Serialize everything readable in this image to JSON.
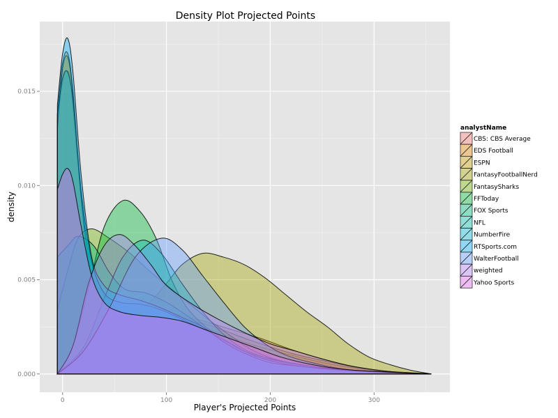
{
  "chart_data": {
    "type": "area",
    "subtype": "density",
    "title": "Density Plot Projected Points",
    "xlabel": "Player's Projected Points",
    "ylabel": "density",
    "xlim": [
      -22,
      373
    ],
    "ylim": [
      -0.00097,
      0.0187
    ],
    "x_ticks": [
      0,
      100,
      200,
      300
    ],
    "x_tick_labels": [
      "0",
      "100",
      "200",
      "300"
    ],
    "y_ticks": [
      0.0,
      0.005,
      0.01,
      0.015
    ],
    "y_tick_labels": [
      "0.000",
      "0.005",
      "0.010",
      "0.015"
    ],
    "grid": true,
    "legend": {
      "title": "analystName",
      "position": "right"
    },
    "series": [
      {
        "name": "CBS: CBS Average",
        "color": "#F8766D",
        "points": [
          [
            -5,
            0.0135
          ],
          [
            0,
            0.0155
          ],
          [
            4,
            0.0161
          ],
          [
            8,
            0.0153
          ],
          [
            15,
            0.011
          ],
          [
            25,
            0.0065
          ],
          [
            40,
            0.0042
          ],
          [
            60,
            0.0036
          ],
          [
            80,
            0.0035
          ],
          [
            100,
            0.0033
          ],
          [
            130,
            0.0029
          ],
          [
            160,
            0.0024
          ],
          [
            190,
            0.0019
          ],
          [
            220,
            0.0013
          ],
          [
            250,
            0.0008
          ],
          [
            280,
            0.0004
          ],
          [
            320,
            0.0001
          ],
          [
            355,
            0.0
          ]
        ]
      },
      {
        "name": "EDS Football",
        "color": "#E58700",
        "points": [
          [
            -5,
            0.0138
          ],
          [
            0,
            0.0165
          ],
          [
            5,
            0.017
          ],
          [
            10,
            0.015
          ],
          [
            18,
            0.0095
          ],
          [
            28,
            0.0055
          ],
          [
            45,
            0.0038
          ],
          [
            70,
            0.0033
          ],
          [
            100,
            0.003
          ],
          [
            140,
            0.0024
          ],
          [
            180,
            0.0016
          ],
          [
            220,
            0.001
          ],
          [
            260,
            0.0005
          ],
          [
            300,
            0.0002
          ],
          [
            355,
            0.0
          ]
        ]
      },
      {
        "name": "ESPN",
        "color": "#C99800",
        "points": [
          [
            -5,
            0.013
          ],
          [
            0,
            0.0162
          ],
          [
            5,
            0.0168
          ],
          [
            10,
            0.0148
          ],
          [
            18,
            0.0092
          ],
          [
            28,
            0.0052
          ],
          [
            45,
            0.0037
          ],
          [
            70,
            0.0034
          ],
          [
            100,
            0.0031
          ],
          [
            140,
            0.0026
          ],
          [
            180,
            0.0018
          ],
          [
            220,
            0.0011
          ],
          [
            260,
            0.0006
          ],
          [
            300,
            0.0002
          ],
          [
            355,
            0.0
          ]
        ]
      },
      {
        "name": "FantasyFootballNerd",
        "color": "#A3A500",
        "points": [
          [
            -5,
            0.0
          ],
          [
            20,
            0.0012
          ],
          [
            50,
            0.0025
          ],
          [
            80,
            0.0036
          ],
          [
            100,
            0.0048
          ],
          [
            115,
            0.0058
          ],
          [
            135,
            0.0064
          ],
          [
            155,
            0.0062
          ],
          [
            175,
            0.0058
          ],
          [
            195,
            0.0051
          ],
          [
            215,
            0.0042
          ],
          [
            235,
            0.0033
          ],
          [
            255,
            0.0025
          ],
          [
            275,
            0.0016
          ],
          [
            295,
            0.0009
          ],
          [
            315,
            0.0005
          ],
          [
            335,
            0.0002
          ],
          [
            355,
            0.0
          ]
        ]
      },
      {
        "name": "FantasySharks",
        "color": "#6BB100",
        "points": [
          [
            -5,
            0.0034
          ],
          [
            5,
            0.0055
          ],
          [
            15,
            0.0072
          ],
          [
            28,
            0.0077
          ],
          [
            45,
            0.0072
          ],
          [
            65,
            0.0064
          ],
          [
            85,
            0.0054
          ],
          [
            105,
            0.0045
          ],
          [
            125,
            0.0036
          ],
          [
            145,
            0.0027
          ],
          [
            165,
            0.0019
          ],
          [
            185,
            0.0012
          ],
          [
            210,
            0.0007
          ],
          [
            240,
            0.0004
          ],
          [
            280,
            0.0002
          ],
          [
            355,
            0.0
          ]
        ]
      },
      {
        "name": "FFToday",
        "color": "#00BA38",
        "points": [
          [
            -5,
            0.0
          ],
          [
            10,
            0.0015
          ],
          [
            25,
            0.0045
          ],
          [
            40,
            0.0078
          ],
          [
            58,
            0.0092
          ],
          [
            75,
            0.0086
          ],
          [
            90,
            0.0072
          ],
          [
            105,
            0.005
          ],
          [
            120,
            0.0035
          ],
          [
            140,
            0.0024
          ],
          [
            160,
            0.0017
          ],
          [
            180,
            0.0011
          ],
          [
            210,
            0.0007
          ],
          [
            250,
            0.0003
          ],
          [
            300,
            0.0001
          ],
          [
            355,
            0.0
          ]
        ]
      },
      {
        "name": "FOX Sports",
        "color": "#00BF7D",
        "points": [
          [
            -5,
            0.0062
          ],
          [
            5,
            0.0068
          ],
          [
            15,
            0.0073
          ],
          [
            30,
            0.0068
          ],
          [
            45,
            0.0054
          ],
          [
            60,
            0.0045
          ],
          [
            80,
            0.0043
          ],
          [
            100,
            0.0038
          ],
          [
            125,
            0.0029
          ],
          [
            150,
            0.0019
          ],
          [
            175,
            0.0011
          ],
          [
            205,
            0.0007
          ],
          [
            240,
            0.0004
          ],
          [
            280,
            0.0002
          ],
          [
            355,
            0.0
          ]
        ]
      },
      {
        "name": "NFL",
        "color": "#00C0AF",
        "points": [
          [
            -5,
            0.0
          ],
          [
            20,
            0.0014
          ],
          [
            40,
            0.004
          ],
          [
            58,
            0.0062
          ],
          [
            77,
            0.0071
          ],
          [
            95,
            0.0064
          ],
          [
            115,
            0.0048
          ],
          [
            135,
            0.0033
          ],
          [
            155,
            0.0021
          ],
          [
            175,
            0.0013
          ],
          [
            200,
            0.0008
          ],
          [
            230,
            0.0005
          ],
          [
            270,
            0.0002
          ],
          [
            355,
            0.0
          ]
        ]
      },
      {
        "name": "NumberFire",
        "color": "#00BCD8",
        "points": [
          [
            -5,
            0.0138
          ],
          [
            0,
            0.0157
          ],
          [
            5,
            0.016
          ],
          [
            10,
            0.0145
          ],
          [
            18,
            0.0097
          ],
          [
            28,
            0.006
          ],
          [
            40,
            0.0043
          ],
          [
            55,
            0.0038
          ],
          [
            75,
            0.0037
          ],
          [
            95,
            0.0034
          ],
          [
            115,
            0.0029
          ],
          [
            135,
            0.0024
          ],
          [
            155,
            0.0018
          ],
          [
            175,
            0.0012
          ],
          [
            200,
            0.0007
          ],
          [
            230,
            0.0004
          ],
          [
            270,
            0.0002
          ],
          [
            355,
            0.0
          ]
        ]
      },
      {
        "name": "RTSports.com",
        "color": "#00B0F6",
        "points": [
          [
            -5,
            0.0143
          ],
          [
            0,
            0.017
          ],
          [
            5,
            0.0178
          ],
          [
            10,
            0.016
          ],
          [
            18,
            0.0105
          ],
          [
            28,
            0.0062
          ],
          [
            40,
            0.0047
          ],
          [
            55,
            0.0042
          ],
          [
            75,
            0.0039
          ],
          [
            95,
            0.0035
          ],
          [
            115,
            0.003
          ],
          [
            135,
            0.0025
          ],
          [
            155,
            0.0017
          ],
          [
            175,
            0.0011
          ],
          [
            200,
            0.0006
          ],
          [
            230,
            0.0004
          ],
          [
            270,
            0.0002
          ],
          [
            355,
            0.0
          ]
        ]
      },
      {
        "name": "WalterFootball",
        "color": "#619CFF",
        "points": [
          [
            -5,
            0.0
          ],
          [
            20,
            0.0012
          ],
          [
            45,
            0.0035
          ],
          [
            70,
            0.0062
          ],
          [
            95,
            0.0072
          ],
          [
            115,
            0.0066
          ],
          [
            135,
            0.0052
          ],
          [
            155,
            0.0038
          ],
          [
            175,
            0.0025
          ],
          [
            195,
            0.0016
          ],
          [
            215,
            0.001
          ],
          [
            240,
            0.0006
          ],
          [
            280,
            0.0002
          ],
          [
            355,
            0.0
          ]
        ]
      },
      {
        "name": "weighted",
        "color": "#B983FF",
        "points": [
          [
            -5,
            0.0
          ],
          [
            10,
            0.0015
          ],
          [
            25,
            0.0048
          ],
          [
            40,
            0.0068
          ],
          [
            55,
            0.0074
          ],
          [
            70,
            0.0068
          ],
          [
            85,
            0.0058
          ],
          [
            100,
            0.0047
          ],
          [
            125,
            0.0037
          ],
          [
            150,
            0.0029
          ],
          [
            175,
            0.0022
          ],
          [
            200,
            0.0016
          ],
          [
            225,
            0.0012
          ],
          [
            250,
            0.0008
          ],
          [
            280,
            0.0004
          ],
          [
            320,
            0.0001
          ],
          [
            355,
            0.0
          ]
        ]
      },
      {
        "name": "Yahoo Sports",
        "color": "#E76BF3",
        "points": [
          [
            -5,
            0.0098
          ],
          [
            0,
            0.0106
          ],
          [
            5,
            0.0109
          ],
          [
            10,
            0.0102
          ],
          [
            18,
            0.0078
          ],
          [
            28,
            0.0052
          ],
          [
            40,
            0.0038
          ],
          [
            55,
            0.0033
          ],
          [
            75,
            0.0031
          ],
          [
            95,
            0.003
          ],
          [
            115,
            0.0028
          ],
          [
            135,
            0.0024
          ],
          [
            160,
            0.0019
          ],
          [
            185,
            0.0014
          ],
          [
            210,
            0.0009
          ],
          [
            240,
            0.0005
          ],
          [
            280,
            0.0002
          ],
          [
            355,
            0.0
          ]
        ]
      }
    ]
  }
}
